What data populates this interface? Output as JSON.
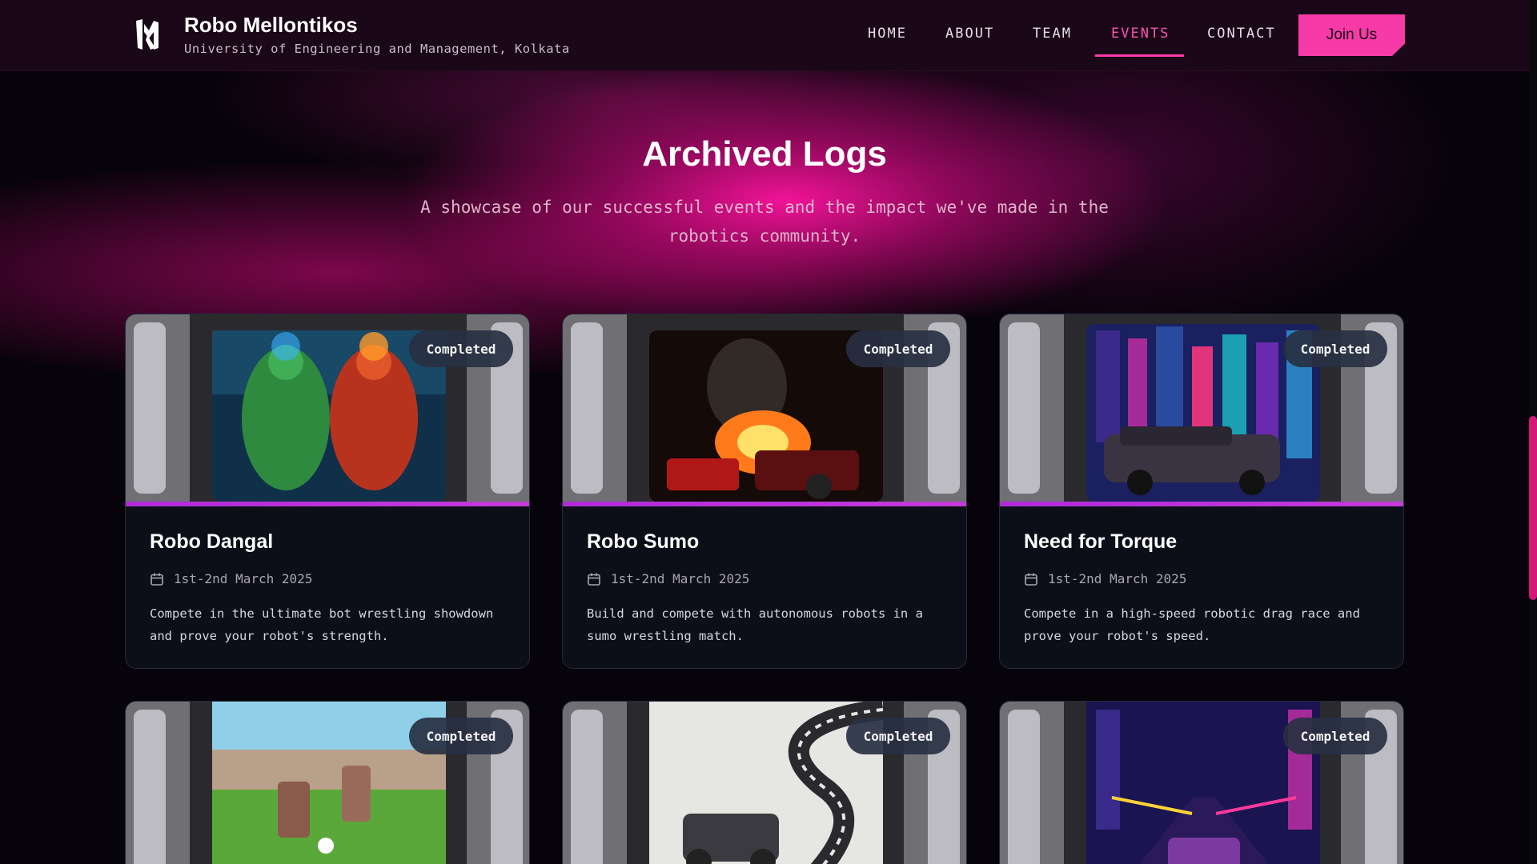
{
  "brand": {
    "title": "Robo Mellontikos",
    "subtitle": "University of Engineering and Management, Kolkata"
  },
  "nav": {
    "items": [
      {
        "label": "HOME"
      },
      {
        "label": "ABOUT"
      },
      {
        "label": "TEAM"
      },
      {
        "label": "EVENTS",
        "active": true
      },
      {
        "label": "CONTACT"
      }
    ],
    "cta": "Join Us"
  },
  "header": {
    "title": "Archived Logs",
    "subtitle": "A showcase of our successful events and the impact we've made in the robotics community."
  },
  "colors": {
    "accent": "#f63aa8",
    "nav_active": "#ff4fb6",
    "card_bar": "#b02bd8",
    "card_bg": "#0d0f18"
  },
  "events": [
    {
      "title": "Robo Dangal",
      "date": "1st-2nd March 2025",
      "description": "Compete in the ultimate bot wrestling showdown and prove your robot's strength.",
      "status": "Completed",
      "image": "fighting-robots"
    },
    {
      "title": "Robo Sumo",
      "date": "1st-2nd March 2025",
      "description": "Build and compete with autonomous robots in a sumo wrestling match.",
      "status": "Completed",
      "image": "burning-cars"
    },
    {
      "title": "Need for Torque",
      "date": "1st-2nd March 2025",
      "description": "Compete in a high-speed robotic drag race and prove your robot's speed.",
      "status": "Completed",
      "image": "neon-city-car"
    },
    {
      "status": "Completed",
      "image": "robot-soccer"
    },
    {
      "status": "Completed",
      "image": "sketch-racetrack"
    },
    {
      "status": "Completed",
      "image": "neon-racer"
    }
  ]
}
